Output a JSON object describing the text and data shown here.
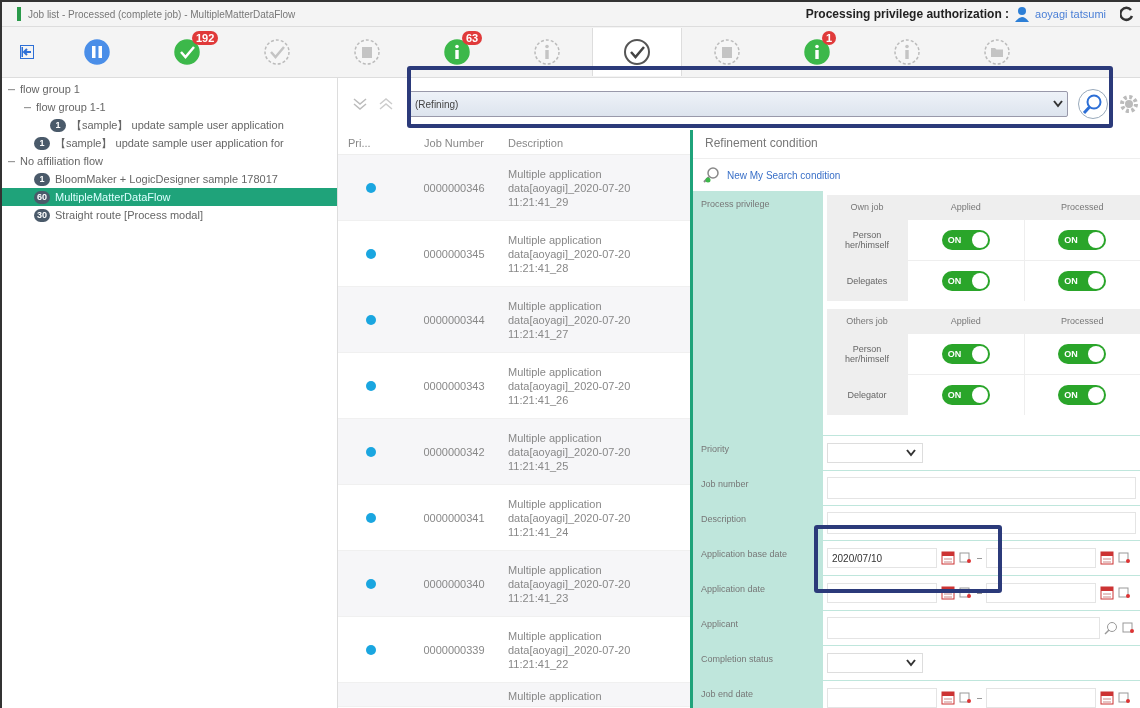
{
  "window": {
    "title": "Job list - Processed (complete job) - MultipleMatterDataFlow",
    "privilege_label": "Processing privilege authorization :",
    "user": "aoyagi tatsumi"
  },
  "toolbar": [
    {
      "kind": "pause",
      "active": true,
      "selected": false
    },
    {
      "kind": "check",
      "active": true,
      "badge": "192",
      "selected": false
    },
    {
      "kind": "check",
      "active": false,
      "selected": false
    },
    {
      "kind": "box",
      "active": false,
      "selected": false
    },
    {
      "kind": "info",
      "active": true,
      "badge": "63",
      "selected": false
    },
    {
      "kind": "info",
      "active": false,
      "selected": false
    },
    {
      "kind": "check",
      "active": false,
      "selected": true
    },
    {
      "kind": "box",
      "active": false,
      "selected": false
    },
    {
      "kind": "info",
      "active": true,
      "badge": "1",
      "selected": false
    },
    {
      "kind": "info",
      "active": false,
      "selected": false
    },
    {
      "kind": "folder",
      "active": false,
      "selected": false
    }
  ],
  "tree": [
    {
      "label": "flow group 1",
      "expanded": true,
      "children": [
        {
          "label": "flow group 1-1",
          "expanded": true,
          "children": [
            {
              "count": "1",
              "label": "【sample】 update sample user application",
              "selected": false
            }
          ]
        },
        {
          "count": "1",
          "label": "【sample】 update sample user application for",
          "selected": false
        }
      ]
    },
    {
      "label": "No affiliation flow",
      "expanded": true,
      "children": [
        {
          "count": "1",
          "label": "BloomMaker + LogicDesigner sample 178017",
          "selected": false
        },
        {
          "count": "60",
          "label": "MultipleMatterDataFlow",
          "selected": true
        },
        {
          "count": "30",
          "label": "Straight route [Process modal]",
          "selected": false
        }
      ]
    }
  ],
  "search": {
    "value": "(Refining)"
  },
  "table": {
    "columns": [
      "Pri...",
      "Job Number",
      "Description"
    ],
    "rows": [
      {
        "color": "#1aa6e0",
        "number": "0000000346",
        "description": "Multiple application data[aoyagi]_2020-07-20 11:21:41_29"
      },
      {
        "color": "#1aa6e0",
        "number": "0000000345",
        "description": "Multiple application data[aoyagi]_2020-07-20 11:21:41_28"
      },
      {
        "color": "#1aa6e0",
        "number": "0000000344",
        "description": "Multiple application data[aoyagi]_2020-07-20 11:21:41_27"
      },
      {
        "color": "#1aa6e0",
        "number": "0000000343",
        "description": "Multiple application data[aoyagi]_2020-07-20 11:21:41_26"
      },
      {
        "color": "#1aa6e0",
        "number": "0000000342",
        "description": "Multiple application data[aoyagi]_2020-07-20 11:21:41_25"
      },
      {
        "color": "#1aa6e0",
        "number": "0000000341",
        "description": "Multiple application data[aoyagi]_2020-07-20 11:21:41_24"
      },
      {
        "color": "#1aa6e0",
        "number": "0000000340",
        "description": "Multiple application data[aoyagi]_2020-07-20 11:21:41_23"
      },
      {
        "color": "#1aa6e0",
        "number": "0000000339",
        "description": "Multiple application data[aoyagi]_2020-07-20 11:21:41_22"
      },
      {
        "description": "Multiple application"
      }
    ]
  },
  "refinement": {
    "title": "Refinement condition",
    "link": "New My Search condition",
    "privilege_label": "Process privilege",
    "privilege_tables": [
      {
        "columns": [
          "Own job",
          "Applied",
          "Processed"
        ],
        "rows": [
          {
            "label": "Person her/himself",
            "toggles": [
              {
                "text": "ON",
                "on": true
              },
              {
                "text": "ON",
                "on": true
              }
            ]
          },
          {
            "label": "Delegates",
            "toggles": [
              {
                "text": "ON",
                "on": true
              },
              {
                "text": "ON",
                "on": true
              }
            ]
          }
        ]
      },
      {
        "columns": [
          "Others job",
          "Applied",
          "Processed"
        ],
        "rows": [
          {
            "label": "Person her/himself",
            "toggles": [
              {
                "text": "ON",
                "on": true
              },
              {
                "text": "ON",
                "on": true
              }
            ]
          },
          {
            "label": "Delegator",
            "toggles": [
              {
                "text": "ON",
                "on": true
              },
              {
                "text": "ON",
                "on": true
              }
            ]
          }
        ]
      }
    ],
    "fields": [
      {
        "kind": "select",
        "label": "Priority"
      },
      {
        "kind": "text",
        "label": "Job number"
      },
      {
        "kind": "text",
        "label": "Description"
      },
      {
        "kind": "daterange",
        "label": "Application base date",
        "value": "2020/07/10"
      },
      {
        "kind": "daterange",
        "label": "Application date"
      },
      {
        "kind": "search",
        "label": "Applicant"
      },
      {
        "kind": "select",
        "label": "Completion status"
      },
      {
        "kind": "daterange",
        "label": "Job end date"
      }
    ]
  }
}
